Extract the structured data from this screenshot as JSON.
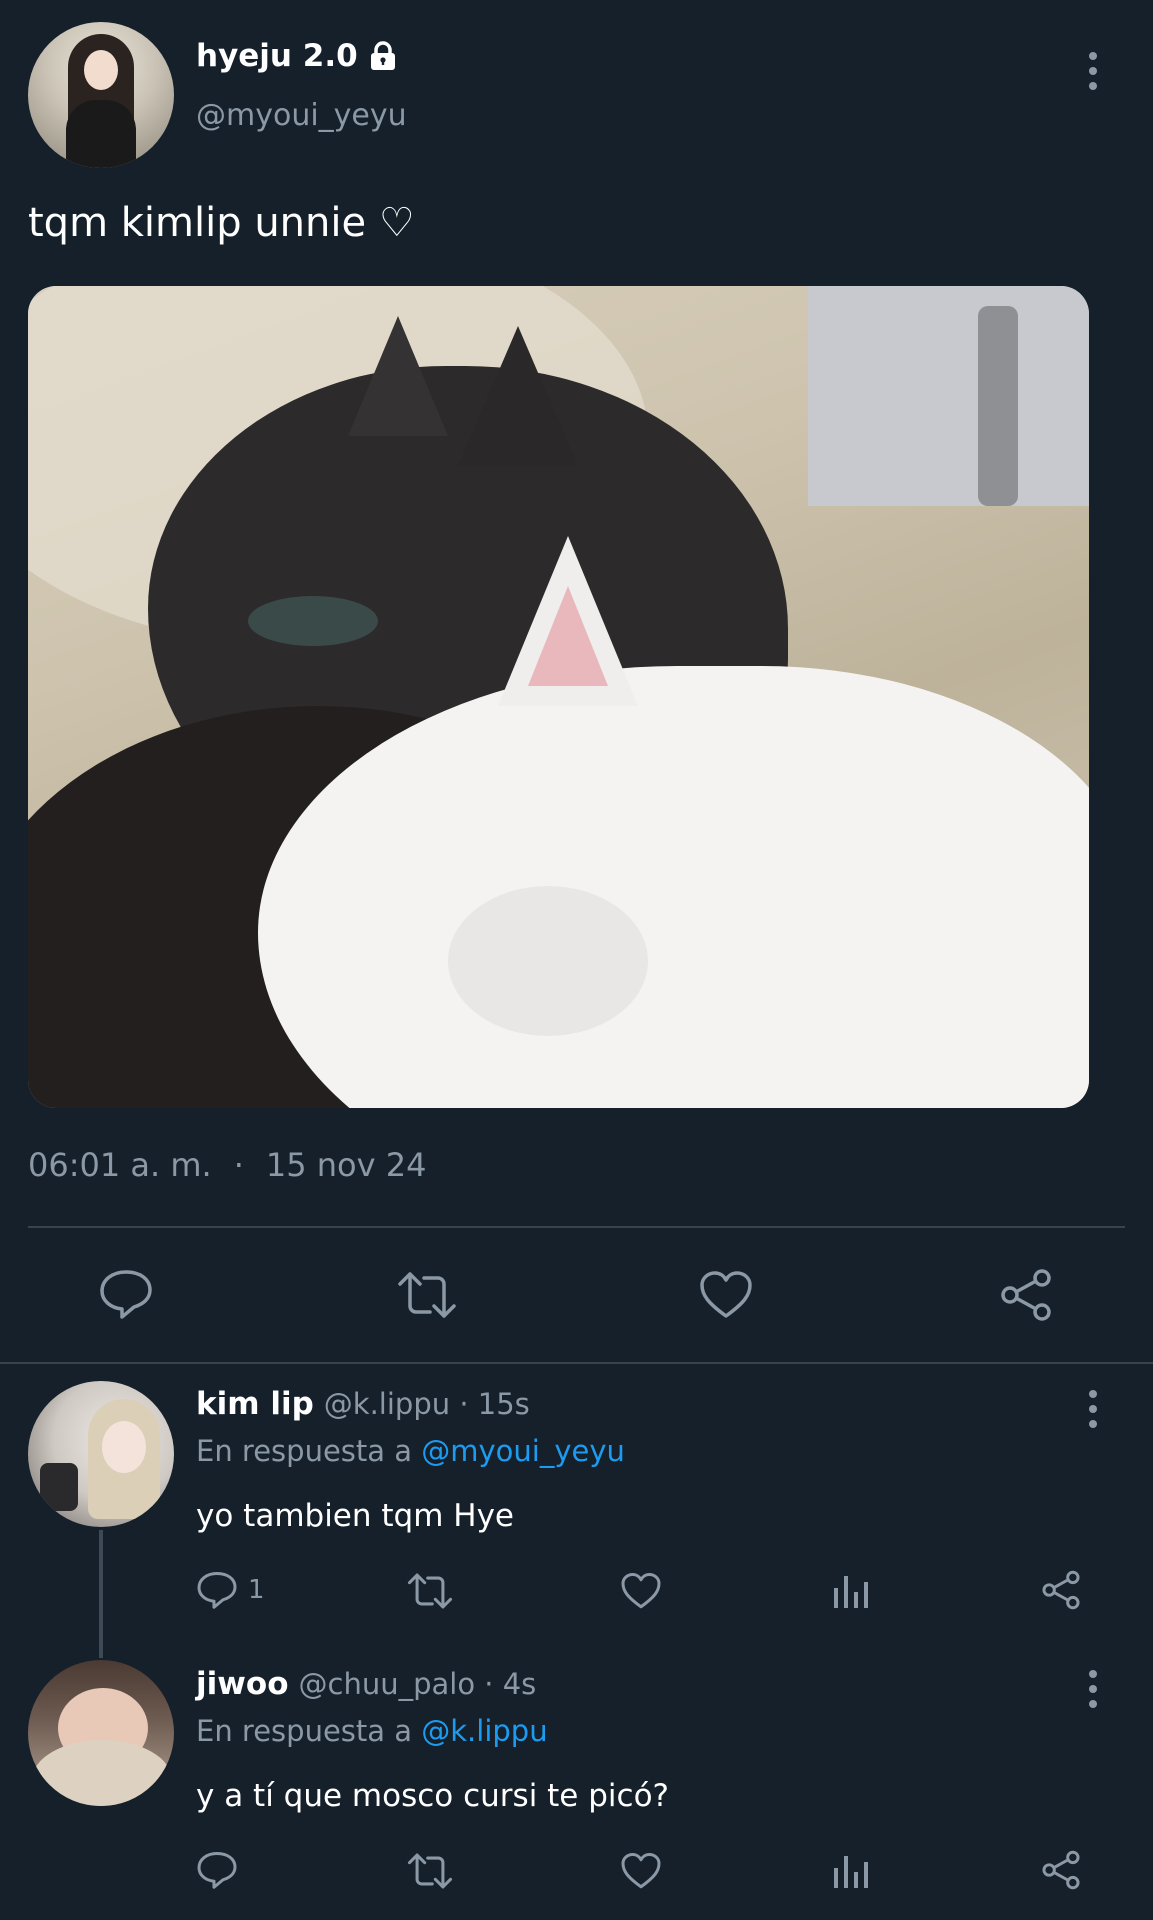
{
  "tweet": {
    "display_name": "hyeju 2.0",
    "handle": "@myoui_yeyu",
    "text": "tqm kimlip unnie ♡",
    "time": "06:01 a. m.",
    "separator": "·",
    "date": "15 nov 24"
  },
  "replies": [
    {
      "display_name": "kim lip",
      "meta": "@k.lippu · 15s",
      "reply_prefix": "En respuesta a",
      "reply_to": "@myoui_yeyu",
      "text": "yo tambien tqm Hye",
      "reply_count": "1"
    },
    {
      "display_name": "jiwoo",
      "meta": "@chuu_palo · 4s",
      "reply_prefix": "En respuesta a",
      "reply_to": "@k.lippu",
      "text": "y a tí que mosco cursi te picó?",
      "reply_count": ""
    }
  ],
  "icons": [
    "lock-icon",
    "more-icon",
    "reply-icon",
    "retweet-icon",
    "like-icon",
    "share-icon",
    "views-icon"
  ],
  "colors": {
    "background": "#15202b",
    "muted": "#8b98a5",
    "link": "#1d9bf0",
    "divider": "#38444d"
  }
}
